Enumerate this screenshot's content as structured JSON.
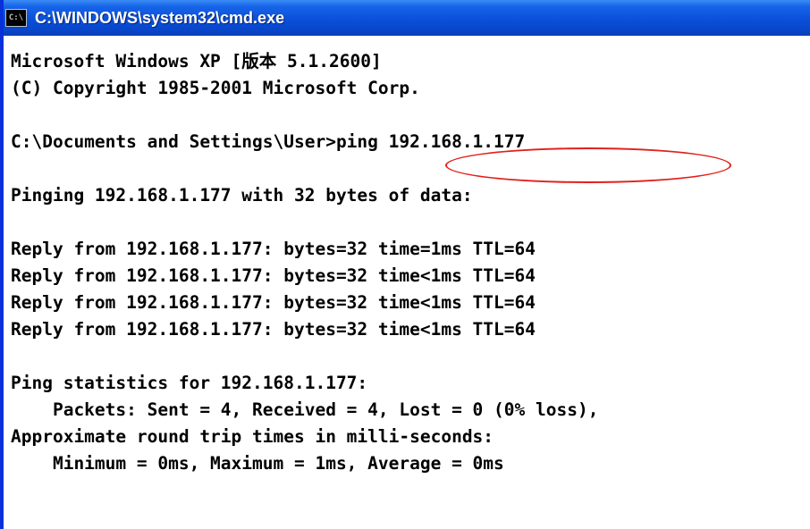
{
  "window": {
    "title": "C:\\WINDOWS\\system32\\cmd.exe",
    "icon_name": "cmd-console-icon",
    "icon_glyph": "C:\\",
    "accent_color": "#0a4fd9",
    "annotation_color": "#e0201b"
  },
  "console": {
    "lines": [
      "Microsoft Windows XP [版本 5.1.2600]",
      "(C) Copyright 1985-2001 Microsoft Corp.",
      "",
      "C:\\Documents and Settings\\User>ping 192.168.1.177",
      "",
      "Pinging 192.168.1.177 with 32 bytes of data:",
      "",
      "Reply from 192.168.1.177: bytes=32 time=1ms TTL=64",
      "Reply from 192.168.1.177: bytes=32 time<1ms TTL=64",
      "Reply from 192.168.1.177: bytes=32 time<1ms TTL=64",
      "Reply from 192.168.1.177: bytes=32 time<1ms TTL=64",
      "",
      "Ping statistics for 192.168.1.177:",
      "    Packets: Sent = 4, Received = 4, Lost = 0 (0% loss),",
      "Approximate round trip times in milli-seconds:",
      "    Minimum = 0ms, Maximum = 1ms, Average = 0ms"
    ]
  }
}
